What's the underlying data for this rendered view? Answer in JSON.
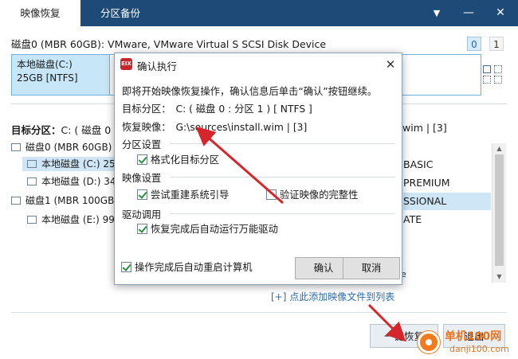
{
  "tabs": [
    {
      "label": "映像恢复"
    },
    {
      "label": "分区备份"
    }
  ],
  "window_controls": {
    "menu": "▼",
    "minimize": "—",
    "close": "✕"
  },
  "disk0_header": "磁盘0 (MBR 60GB): VMware, VMware Virtual S SCSI Disk Device",
  "pager": [
    "0",
    "1"
  ],
  "selected_partition": {
    "name": "本地磁盘(C:)",
    "info": "25GB [NTFS]"
  },
  "target_label_prefix": "目标分区：",
  "target_label_value": "C: ( 磁盘 0 : 分",
  "wim_fragment": "wim | [3]",
  "tree": [
    {
      "label": "磁盘0 (MBR 60GB)"
    },
    {
      "label": "本地磁盘 (C:) 25"
    },
    {
      "label": "本地磁盘 (D:) 34"
    },
    {
      "label": "磁盘1 (MBR 100GB"
    },
    {
      "label": "本地磁盘 (E:) 99"
    }
  ],
  "image_list": [
    "BASIC",
    "PREMIUM",
    "SSIONAL",
    "ATE"
  ],
  "list_fragment_e": "e",
  "add_link": "[+] 点此添加映像文件到列表",
  "buttons": {
    "go": "一键恢复",
    "exit": "退出"
  },
  "watermark": {
    "title": "单机100网",
    "url": "danji100.com"
  },
  "dialog": {
    "logo": "EIX",
    "title": "确认执行",
    "close": "✕",
    "intro": "即将开始映像恢复操作，确认信息后单击“确认”按钮继续。",
    "target_label": "目标分区：",
    "target_value": "C: ( 磁盘 0 : 分区 1 ) [ NTFS ]",
    "source_label": "恢复映像：",
    "source_value": "G:\\sources\\install.wim | [3]",
    "sections": {
      "partition": "分区设置",
      "image": "映像设置",
      "driver": "驱动调用"
    },
    "options": {
      "format": "格式化目标分区",
      "rebuild_boot": "尝试重建系统引导",
      "verify": "验证映像的完整性",
      "run_driver": "恢复完成后自动运行万能驱动",
      "reboot": "操作完成后自动重启计算机"
    },
    "checked": {
      "format": true,
      "rebuild_boot": true,
      "verify": false,
      "run_driver": true,
      "reboot": true
    },
    "ok": "确认",
    "cancel": "取消"
  },
  "colors": {
    "titlebar": "#1e4a78",
    "selection": "#cfe6f7",
    "accent": "#2b6cb0",
    "arrow": "#d7262b",
    "watermark": "#e8731c"
  }
}
